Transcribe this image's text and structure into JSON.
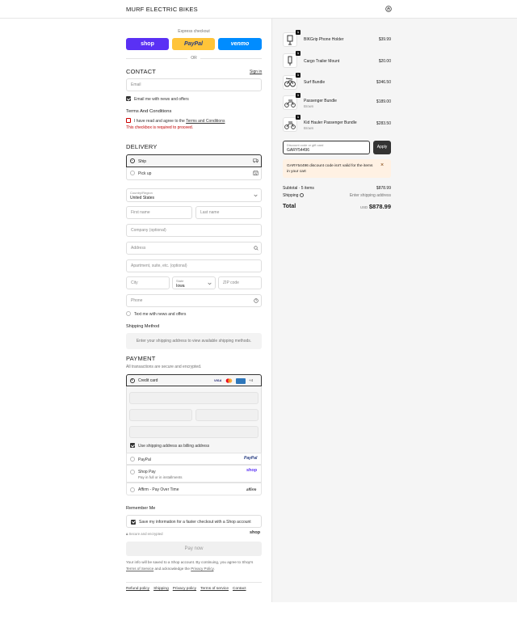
{
  "header": {
    "brand": "MURF ELECTRIC BIKES",
    "bag_icon": "shopping-bag-icon"
  },
  "express": {
    "label": "Express checkout",
    "shop": "shop",
    "paypal": "PayPal",
    "venmo": "venmo",
    "or": "OR"
  },
  "contact": {
    "title": "CONTACT",
    "sign_in": "Sign in",
    "email_placeholder": "Email",
    "news_label": "Email me with news and offers",
    "news_checked": true
  },
  "terms": {
    "title": "Terms And Conditions",
    "label_pre": "I have read and agree to the ",
    "label_link": "Terms and Conditions",
    "error": "This checkbox is required to proceed."
  },
  "delivery": {
    "title": "DELIVERY",
    "ship_label": "Ship",
    "pickup_label": "Pick up",
    "country_label": "Country/Region",
    "country_value": "United States",
    "first_name": "First name",
    "last_name": "Last name",
    "company": "Company (optional)",
    "address": "Address",
    "apartment": "Apartment, suite, etc. (optional)",
    "city": "City",
    "state_label": "State",
    "state_value": "Iowa",
    "zip": "ZIP code",
    "phone": "Phone",
    "text_news": "Text me with news and offers",
    "shipping_method_title": "Shipping Method",
    "shipping_method_note": "Enter your shipping address to view available shipping methods."
  },
  "payment": {
    "title": "PAYMENT",
    "subtitle": "All transactions are secure and encrypted.",
    "credit_card": "Credit card",
    "card_more": "+4",
    "billing_same": "Use shipping address as billing address",
    "paypal": "PayPal",
    "paypal_logo": "PayPal",
    "shoppay": "Shop Pay",
    "shoppay_sub": "Pay in full or in installments",
    "shoppay_logo": "shop",
    "affirm": "Affirm - Pay Over Time",
    "affirm_logo": "affirm"
  },
  "remember": {
    "title": "Remember Me",
    "label": "Save my information for a faster checkout with a Shop account",
    "secure": "Secure and encrypted",
    "shop_logo": "shop"
  },
  "pay_now": "Pay now",
  "disclaimer": {
    "pre": "Your info will be saved to a Shop account. By continuing, you agree to Shop's ",
    "tos": "Terms of Service",
    "mid": " and acknowledge the ",
    "privacy": "Privacy Policy",
    "end": "."
  },
  "footer_links": [
    "Refund policy",
    "Shipping",
    "Privacy policy",
    "Terms of service",
    "Contact"
  ],
  "cart": {
    "items": [
      {
        "name": "BIKGrip Phone Holder",
        "sub": "",
        "price": "$39.99",
        "qty": "1"
      },
      {
        "name": "Cargo Trailer Mount",
        "sub": "",
        "price": "$20.00",
        "qty": "1"
      },
      {
        "name": "Surf Bundle",
        "sub": "",
        "price": "$346.50",
        "qty": "1"
      },
      {
        "name": "Passenger Bundle",
        "sub": "Brown",
        "price": "$189.00",
        "qty": "1"
      },
      {
        "name": "Kid Hauler Passenger Bundle",
        "sub": "Brown",
        "price": "$283.50",
        "qty": "1"
      }
    ],
    "discount_label": "Discount code or gift card",
    "discount_value": "GARY54496",
    "apply": "Apply",
    "discount_error": "GARY54496 discount code isn't valid for the items in your cart",
    "subtotal_label": "Subtotal · 5 items",
    "subtotal": "$878.99",
    "shipping_label": "Shipping",
    "shipping_value": "Enter shipping address",
    "total_label": "Total",
    "currency": "USD",
    "total": "$878.99"
  },
  "colors": {
    "shop": "#5a31f4",
    "paypal": "#ffc439",
    "venmo": "#008cff",
    "error": "#c00000",
    "discount_bg": "#fff1e3"
  }
}
